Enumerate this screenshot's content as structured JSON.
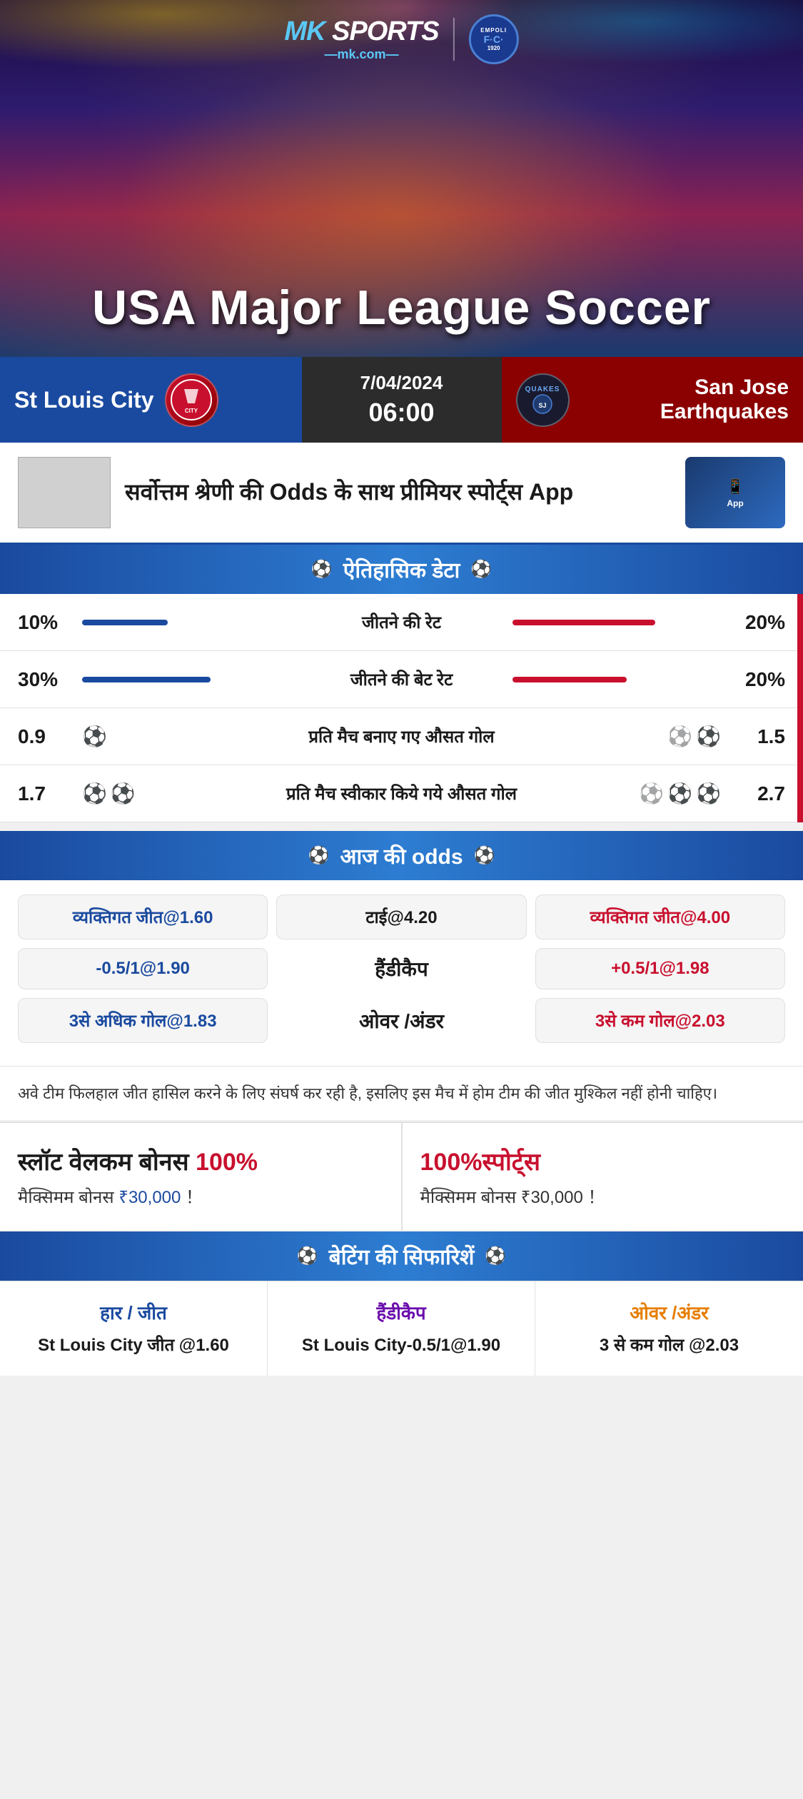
{
  "header": {
    "mk_sports": "MK",
    "sports_label": "SPORTS",
    "mk_com": "mk.com",
    "empoli_label": "EMPOLI F.C.",
    "empoli_year": "1920",
    "banner_title": "USA Major League Soccer"
  },
  "match": {
    "team_left": "St Louis City",
    "team_right": "San Jose Earthquakes",
    "quakes_label": "QUAKES",
    "date": "7/04/2024",
    "time": "06:00"
  },
  "promo": {
    "text": "सर्वोत्तम श्रेणी की Odds के साथ प्रीमियर स्पोर्ट्स App",
    "app_label": "App"
  },
  "historical": {
    "section_title": "ऐतिहासिक डेटा",
    "rows": [
      {
        "left_val": "10%",
        "label": "जीतने की रेट",
        "right_val": "20%",
        "left_bar_width": 120,
        "right_bar_width": 200
      },
      {
        "left_val": "30%",
        "label": "जीतने की बेट रेट",
        "right_val": "20%",
        "left_bar_width": 180,
        "right_bar_width": 160
      },
      {
        "left_val": "0.9",
        "label": "प्रति मैच बनाए गए औसत गोल",
        "right_val": "1.5",
        "left_balls": 1,
        "right_balls": 2
      },
      {
        "left_val": "1.7",
        "label": "प्रति मैच स्वीकार किये गये औसत गोल",
        "right_val": "2.7",
        "left_balls": 2,
        "right_balls": 3
      }
    ]
  },
  "odds": {
    "section_title": "आज की odds",
    "personal_win_left": "व्यक्तिगत जीत@1.60",
    "tie": "टाई@4.20",
    "personal_win_right": "व्यक्तिगत जीत@4.00",
    "handicap_left": "-0.5/1@1.90",
    "handicap_label": "हैंडीकैप",
    "handicap_right": "+0.5/1@1.98",
    "over_left": "3से अधिक गोल@1.83",
    "over_label": "ओवर /अंडर",
    "over_right": "3से कम गोल@2.03"
  },
  "note": {
    "text": "अवे टीम फिलहाल जीत हासिल करने के लिए संघर्ष कर रही है, इसलिए इस मैच में होम टीम की जीत मुश्किल नहीं होनी चाहिए।"
  },
  "bonus": {
    "left_title": "स्लॉट वेलकम बोनस 100%",
    "left_subtitle": "मैक्सिमम बोनस ₹30,000 ！",
    "right_title": "100%स्पोर्ट्स",
    "right_subtitle": "मैक्सिमम बोनस  ₹30,000 ！"
  },
  "betting": {
    "section_title": "बेटिंग की सिफारिशें",
    "cols": [
      {
        "type": "हार / जीत",
        "pick": "St Louis City जीत @1.60"
      },
      {
        "type": "हैंडीकैप",
        "pick": "St Louis City-0.5/1@1.90"
      },
      {
        "type": "ओवर /अंडर",
        "pick": "3 से कम गोल @2.03"
      }
    ]
  }
}
